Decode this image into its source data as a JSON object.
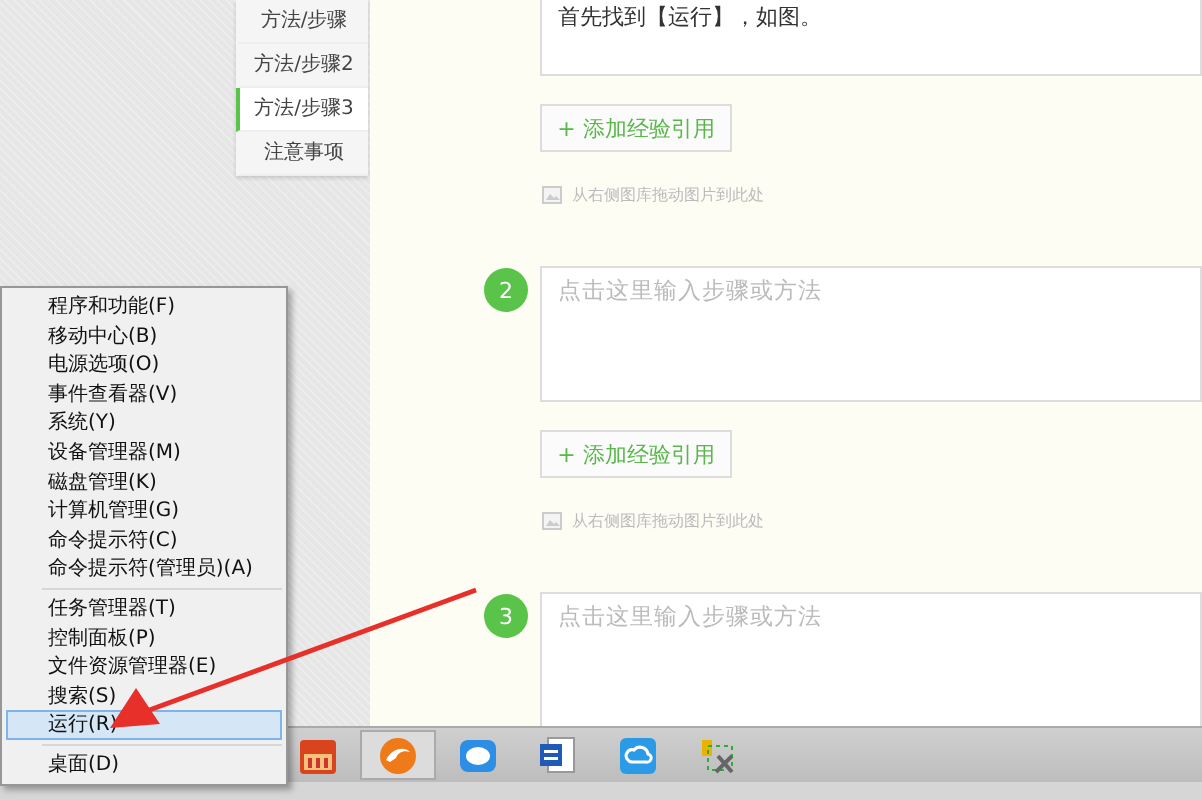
{
  "sidebar": {
    "items": [
      {
        "label": "方法/步骤",
        "selected": false
      },
      {
        "label": "方法/步骤2",
        "selected": false
      },
      {
        "label": "方法/步骤3",
        "selected": true
      },
      {
        "label": "注意事项",
        "selected": false
      }
    ]
  },
  "steps": [
    {
      "text": "首先找到【运行】，如图。",
      "add_button": "+ 添加经验引用",
      "hint": "从右侧图库拖动图片到此处"
    },
    {
      "number": "2",
      "placeholder": "点击这里输入步骤或方法",
      "add_button": "+ 添加经验引用",
      "hint": "从右侧图库拖动图片到此处"
    },
    {
      "number": "3",
      "placeholder": "点击这里输入步骤或方法"
    }
  ],
  "context_menu": {
    "groups": [
      {
        "items": [
          {
            "label": "程序和功能(F)",
            "selected": false
          },
          {
            "label": "移动中心(B)",
            "selected": false
          },
          {
            "label": "电源选项(O)",
            "selected": false
          },
          {
            "label": "事件查看器(V)",
            "selected": false
          },
          {
            "label": "系统(Y)",
            "selected": false
          },
          {
            "label": "设备管理器(M)",
            "selected": false
          },
          {
            "label": "磁盘管理(K)",
            "selected": false
          },
          {
            "label": "计算机管理(G)",
            "selected": false
          },
          {
            "label": "命令提示符(C)",
            "selected": false
          },
          {
            "label": "命令提示符(管理员)(A)",
            "selected": false
          }
        ]
      },
      {
        "items": [
          {
            "label": "任务管理器(T)",
            "selected": false
          },
          {
            "label": "控制面板(P)",
            "selected": false
          },
          {
            "label": "文件资源管理器(E)",
            "selected": false
          },
          {
            "label": "搜索(S)",
            "selected": false
          },
          {
            "label": "运行(R)",
            "selected": true
          }
        ]
      },
      {
        "items": [
          {
            "label": "桌面(D)",
            "selected": false
          }
        ]
      }
    ]
  },
  "taskbar": {
    "buttons": [
      {
        "kind": "calendar",
        "selected": false
      },
      {
        "kind": "browser",
        "selected": true
      },
      {
        "kind": "chat",
        "selected": false
      },
      {
        "kind": "document",
        "selected": false
      },
      {
        "kind": "cloud",
        "selected": false
      },
      {
        "kind": "tools",
        "selected": false
      }
    ]
  }
}
